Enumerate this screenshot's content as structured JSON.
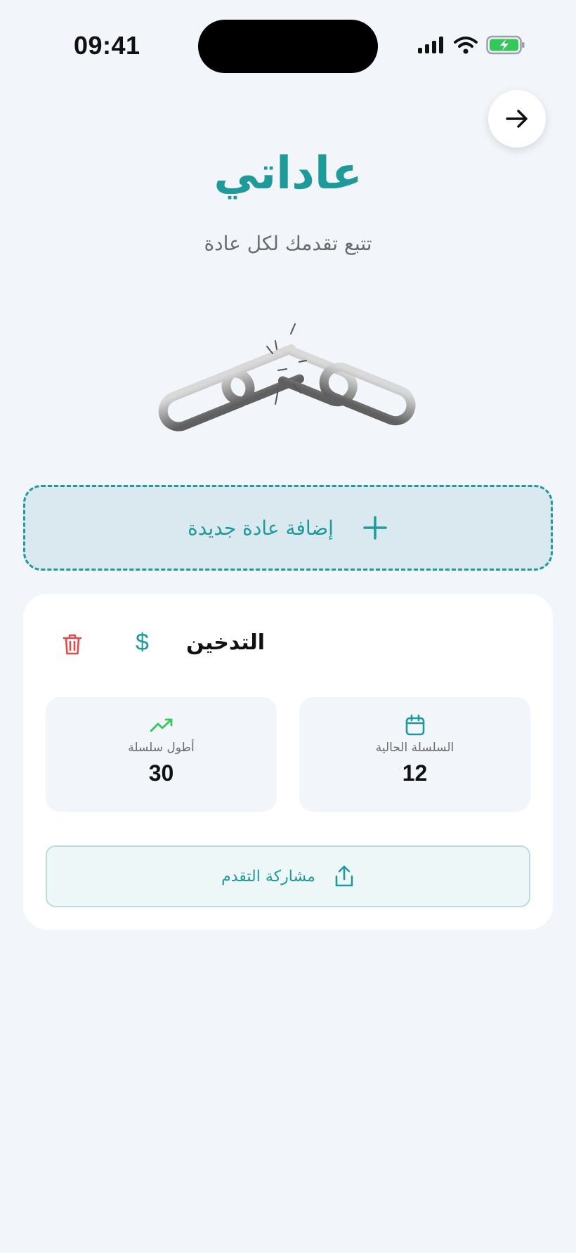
{
  "status_bar": {
    "time": "09:41"
  },
  "header": {
    "title": "عاداتي",
    "subtitle": "تتبع تقدمك لكل عادة"
  },
  "add_habit": {
    "label": "إضافة عادة جديدة"
  },
  "habit": {
    "name": "التدخين",
    "currency_symbol": "$",
    "stats": {
      "current_streak": {
        "label": "السلسلة الحالية",
        "value": "12"
      },
      "longest_streak": {
        "label": "أطول سلسلة",
        "value": "30"
      }
    },
    "share_label": "مشاركة التقدم"
  },
  "colors": {
    "accent": "#1f9a9a",
    "danger": "#e24b4b",
    "success": "#34c759",
    "background": "#f2f5fa"
  },
  "icons": {
    "back": "arrow-right-icon",
    "add": "plus-icon",
    "delete": "trash-icon",
    "current_streak": "calendar-icon",
    "longest_streak": "trending-up-icon",
    "share": "share-icon"
  }
}
